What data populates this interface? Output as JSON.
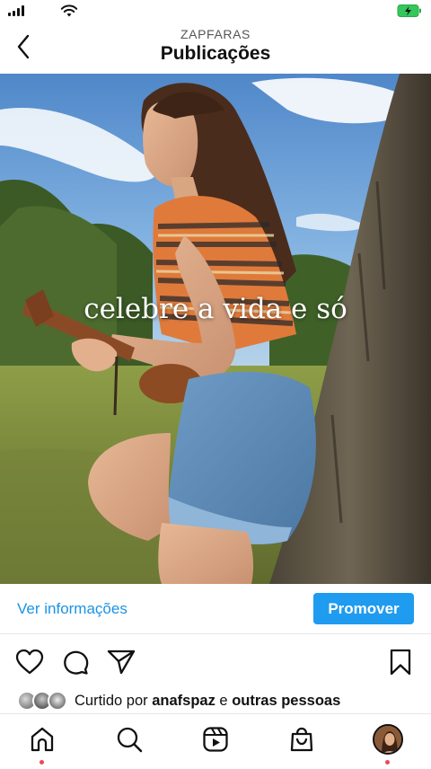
{
  "status_bar": {
    "signal_icon": "cellular-signal-icon",
    "wifi_icon": "wifi-icon",
    "battery_icon": "battery-charging-icon",
    "battery_color": "#34c759"
  },
  "header": {
    "username": "ZAPFARAS",
    "title": "Publicações",
    "back_icon": "chevron-left-icon"
  },
  "post": {
    "overlay_text": "celebre a vida e só"
  },
  "info_row": {
    "ver_informacoes": "Ver informações",
    "promover": "Promover",
    "link_color": "#1a93e6",
    "button_color": "#1f9bf0"
  },
  "actions": {
    "like_icon": "heart-icon",
    "comment_icon": "comment-icon",
    "share_icon": "paper-plane-icon",
    "save_icon": "bookmark-icon"
  },
  "likes": {
    "prefix": "Curtido por",
    "user": "anafspaz",
    "connector": "e",
    "others": "outras pessoas"
  },
  "bottom_nav": {
    "items": [
      "home-icon",
      "search-icon",
      "reels-icon",
      "shop-icon",
      "profile-avatar"
    ],
    "notification_dot_color": "#ed4956"
  }
}
